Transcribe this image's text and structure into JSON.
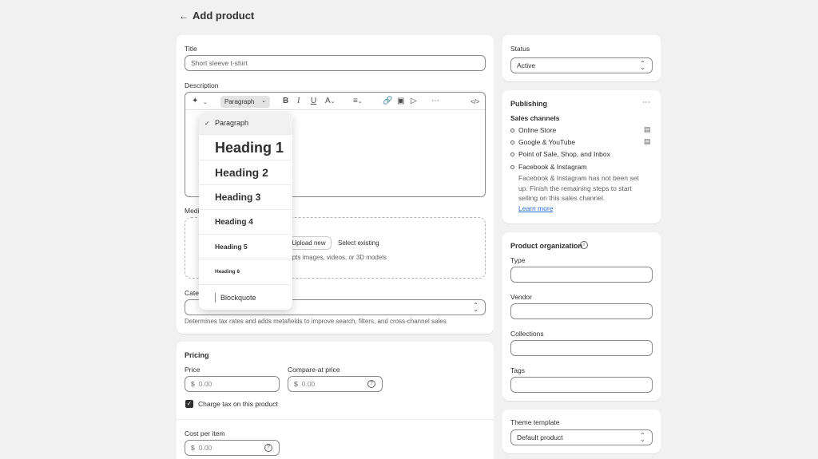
{
  "page": {
    "back_icon": "arrow-left-icon",
    "title": "Add product"
  },
  "main": {
    "title_label": "Title",
    "title_value": "Short sleeve t-shirt",
    "description_label": "Description",
    "toolbar": {
      "format_value": "Paragraph"
    },
    "format_menu": {
      "items": [
        "Paragraph",
        "Heading 1",
        "Heading 2",
        "Heading 3",
        "Heading 4",
        "Heading 5",
        "Heading 6",
        "Blockquote"
      ],
      "selected": "Paragraph"
    },
    "media_label": "Media",
    "media_upload": "Upload new",
    "media_select": "Select existing",
    "media_hint": "Accepts images, videos, or 3D models",
    "category_label": "Category",
    "category_help": "Determines tax rates and adds metafields to improve search, filters, and cross-channel sales"
  },
  "pricing": {
    "heading": "Pricing",
    "price_label": "Price",
    "price_prefix": "$",
    "price_placeholder": "0.00",
    "compare_label": "Compare-at price",
    "compare_prefix": "$",
    "compare_placeholder": "0.00",
    "charge_tax_label": "Charge tax on this product",
    "charge_tax_checked": true,
    "cost_label": "Cost per item",
    "cost_prefix": "$",
    "cost_placeholder": "0.00"
  },
  "status": {
    "heading": "Status",
    "value": "Active"
  },
  "publishing": {
    "heading": "Publishing",
    "sales_channels_label": "Sales channels",
    "channels": [
      "Online Store",
      "Google & YouTube",
      "Point of Sale, Shop, and Inbox",
      "Facebook & Instagram"
    ],
    "facebook_note": [
      "Facebook & Instagram has not been set",
      "up. Finish the remaining steps to start",
      "selling on this sales channel."
    ],
    "learn_more": "Learn more"
  },
  "organization": {
    "heading": "Product organization",
    "type_label": "Type",
    "vendor_label": "Vendor",
    "collections_label": "Collections",
    "tags_label": "Tags"
  },
  "theme": {
    "heading": "Theme template",
    "value": "Default product"
  },
  "colors": {
    "background": "#f1f1f1",
    "card": "#ffffff",
    "link": "#2c6ecb",
    "checkbox": "#303030"
  }
}
